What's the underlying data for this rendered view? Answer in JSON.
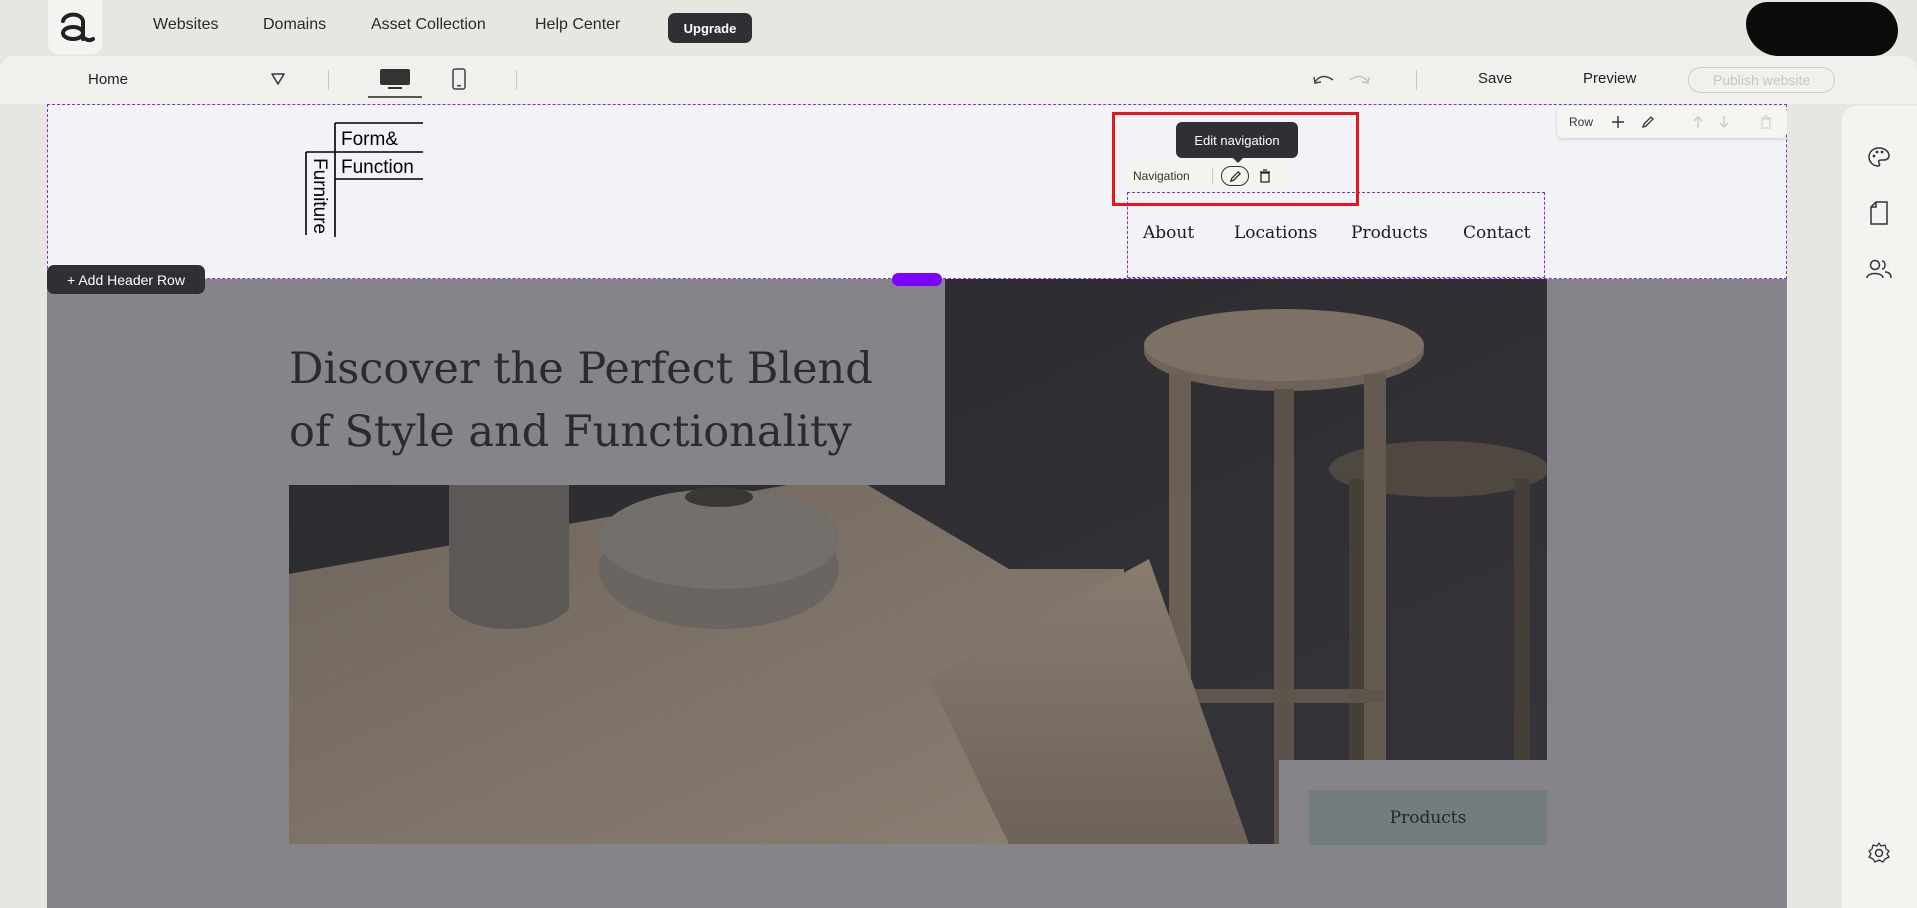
{
  "topbar": {
    "nav": [
      "Websites",
      "Domains",
      "Asset Collection",
      "Help Center"
    ],
    "upgrade_label": "Upgrade"
  },
  "toolbar": {
    "page_name": "Home",
    "save_label": "Save",
    "preview_label": "Preview",
    "publish_label": "Publish website"
  },
  "header": {
    "brand_logo_text": [
      "Form&",
      "Function",
      "Furniture"
    ],
    "row_toolbar_label": "Row",
    "nav_items": [
      "About",
      "Locations",
      "Products",
      "Contact"
    ],
    "nav_element_label": "Navigation",
    "tooltip": "Edit navigation",
    "add_header_row_label": "+ Add Header Row"
  },
  "hero": {
    "title": "Discover the Perfect Blend of Style and Functionality",
    "button_label": "Products"
  },
  "icons": {
    "editor_logo": "editor-logo-icon",
    "page_dropdown": "chevron-down-icon",
    "desktop": "desktop-icon",
    "mobile": "mobile-icon",
    "undo": "undo-icon",
    "redo": "redo-icon",
    "row_add": "plus-icon",
    "row_edit": "pencil-icon",
    "row_up": "arrow-up-icon",
    "row_down": "arrow-down-icon",
    "row_delete": "trash-icon",
    "rail": [
      "palette-icon",
      "page-icon",
      "users-icon",
      "gear-icon"
    ]
  },
  "colors": {
    "accent_purple": "#7b00ff",
    "dashed_outline": "#8a2be2",
    "highlight_red": "#e8141e",
    "dark_button": "#2f2f36"
  }
}
